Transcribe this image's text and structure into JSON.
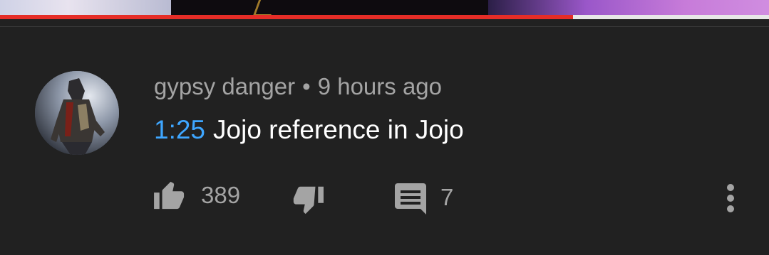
{
  "video": {
    "progress_fraction": 0.745
  },
  "comment": {
    "author": "gypsy danger",
    "separator": "•",
    "time": "9 hours ago",
    "timestamp_link": "1:25",
    "text": "Jojo reference in Jojo",
    "like_count": "389",
    "reply_count": "7"
  },
  "colors": {
    "background": "#212121",
    "link": "#3ea6ff",
    "progress": "#e52d27",
    "secondary_text": "#a4a4a4"
  },
  "icons": {
    "like": "thumbs-up-icon",
    "dislike": "thumbs-down-icon",
    "reply": "comment-icon",
    "more": "more-vert-icon"
  }
}
